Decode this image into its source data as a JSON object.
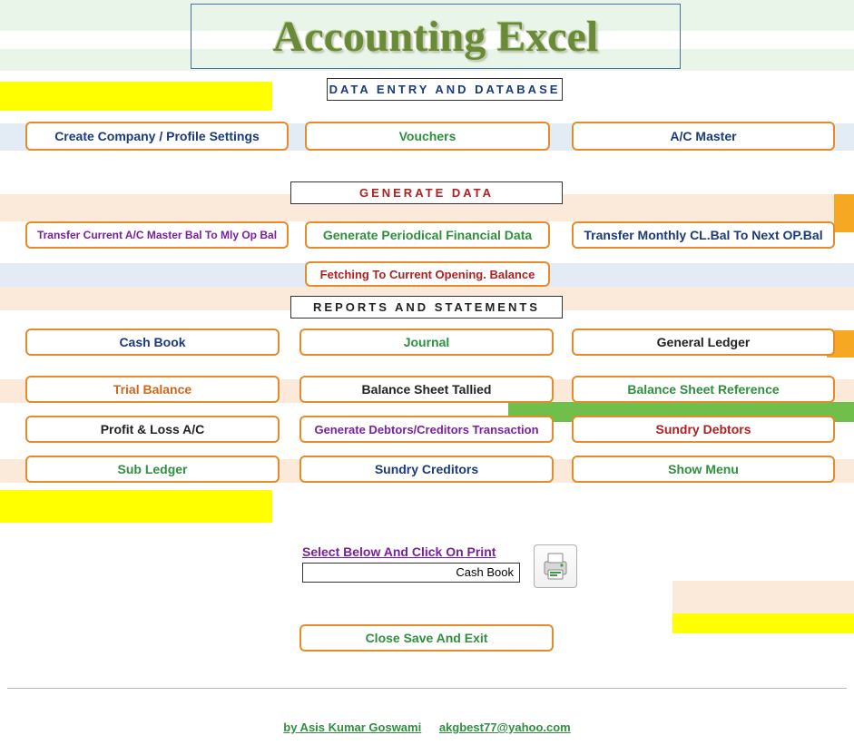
{
  "title": "Accounting Excel",
  "sections": {
    "data_entry": "DATA ENTRY AND DATABASE",
    "generate_data": "GENERATE  DATA",
    "reports": "REPORTS AND STATEMENTS"
  },
  "buttons": {
    "create_company": "Create Company / Profile Settings",
    "vouchers": "Vouchers",
    "ac_master": "A/C  Master",
    "transfer_mly": "Transfer Current  A/C Master Bal  To Mly Op Bal",
    "gen_periodical": "Generate Periodical Financial Data",
    "transfer_monthly": "Transfer Monthly  CL.Bal To Next OP.Bal",
    "fetching": "Fetching  To Current Opening. Balance",
    "cash_book": "Cash Book",
    "journal": "Journal",
    "general_ledger": "General Ledger",
    "trial_balance": "Trial Balance",
    "balance_tallied": "Balance Sheet Tallied",
    "balance_ref": "Balance Sheet Reference",
    "profit_loss": "Profit & Loss A/C",
    "gen_debtors": "Generate Debtors/Creditors Transaction",
    "sundry_debtors": "Sundry Debtors",
    "sub_ledger": "Sub Ledger",
    "sundry_creditors": "Sundry Creditors",
    "show_menu": "Show Menu",
    "close_save": "Close Save And Exit"
  },
  "print": {
    "label": "Select Below And Click On Print",
    "value": "Cash Book"
  },
  "footer": {
    "author": "by Asis Kumar Goswami",
    "email": "akgbest77@yahoo.com"
  }
}
